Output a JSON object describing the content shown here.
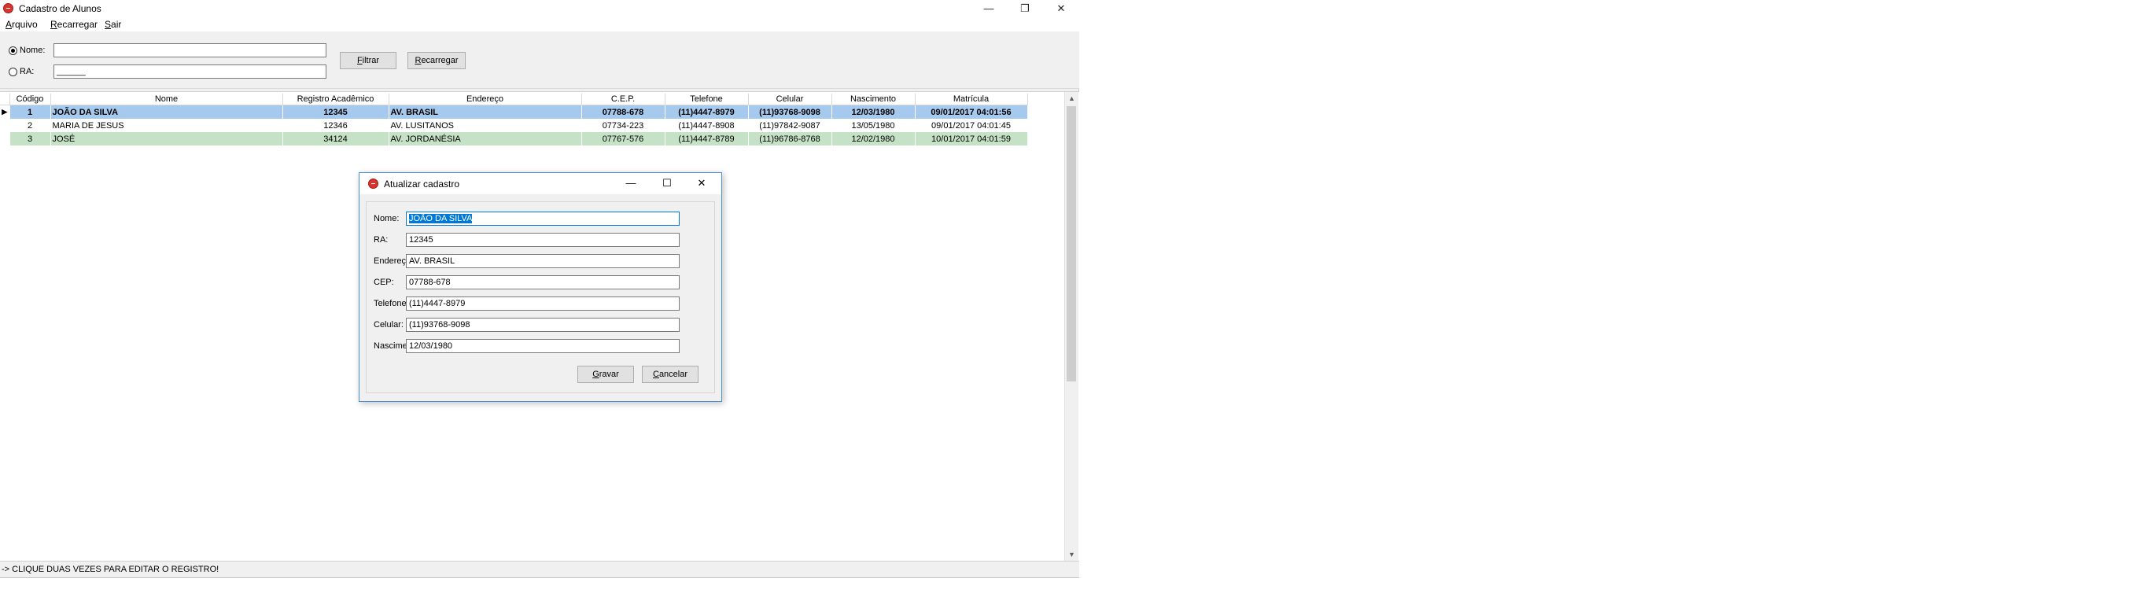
{
  "window": {
    "title": "Cadastro de Alunos"
  },
  "menu": [
    {
      "label": "Arquivo",
      "accel": "A",
      "rest": "rquivo"
    },
    {
      "label": "Recarregar",
      "accel": "R",
      "rest": "ecarregar"
    },
    {
      "label": "Sair",
      "accel": "S",
      "rest": "air"
    }
  ],
  "filter": {
    "nome_label": "Nome:",
    "nome_value": "",
    "ra_label": "RA:",
    "ra_mask": "______",
    "selected": "nome",
    "filtrar_accel": "F",
    "filtrar_rest": "iltrar",
    "recarregar_accel": "R",
    "recarregar_rest": "ecarregar"
  },
  "grid": {
    "columns": [
      "Código",
      "Nome",
      "Registro Acadêmico",
      "Endereço",
      "C.E.P.",
      "Telefone",
      "Celular",
      "Nascimento",
      "Matrícula"
    ],
    "rows": [
      [
        "1",
        "JOÃO DA SILVA",
        "12345",
        "AV. BRASIL",
        "07788-678",
        "(11)4447-8979",
        "(11)93768-9098",
        "12/03/1980",
        "09/01/2017 04:01:56"
      ],
      [
        "2",
        "MARIA DE JESUS",
        "12346",
        "AV. LUSITANOS",
        "07734-223",
        "(11)4447-8908",
        "(11)97842-9087",
        "13/05/1980",
        "09/01/2017 04:01:45"
      ],
      [
        "3",
        "JOSÉ",
        "34124",
        "AV. JORDANÉSIA",
        "07767-576",
        "(11)4447-8789",
        "(11)96786-8768",
        "12/02/1980",
        "10/01/2017 04:01:59"
      ]
    ],
    "selected_row": 0
  },
  "status": {
    "text": "-> CLIQUE DUAS VEZES PARA EDITAR O REGISTRO!"
  },
  "dialog": {
    "title": "Atualizar cadastro",
    "fields": [
      {
        "label": "Nome:",
        "value": "JOÃO DA SILVA"
      },
      {
        "label": "RA:",
        "value": "12345"
      },
      {
        "label": "Endereço:",
        "value": "AV. BRASIL"
      },
      {
        "label": "CEP:",
        "value": "07788-678"
      },
      {
        "label": "Telefone:",
        "value": "(11)4447-8979"
      },
      {
        "label": "Celular:",
        "value": "(11)93768-9098"
      },
      {
        "label": "Nascimento:",
        "value": "12/03/1980"
      }
    ],
    "gravar_accel": "G",
    "gravar_rest": "ravar",
    "cancelar_accel": "C",
    "cancelar_rest": "ancelar"
  },
  "icons": {
    "app": "app-icon",
    "minimize": "minimize-icon",
    "maximize": "restore-icon",
    "close": "close-icon",
    "row_indicator": "current-row-arrow-icon"
  },
  "colors": {
    "selection": "#a6c9ee",
    "alt_row": "#c6e2c6",
    "focus": "#0078d7",
    "app_icon": "#d8342e"
  }
}
